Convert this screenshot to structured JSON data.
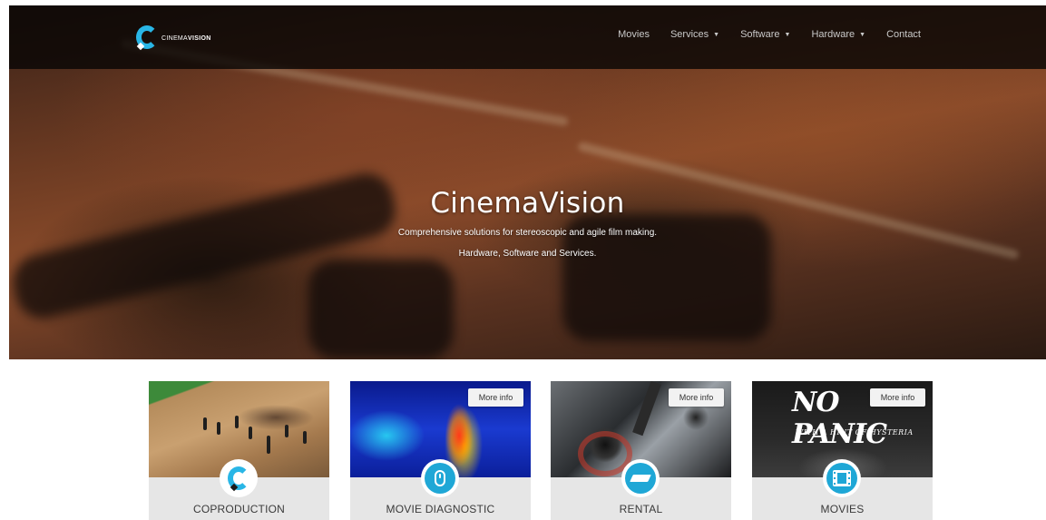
{
  "brand": {
    "name_light": "CINEMA",
    "name_bold": "VISION",
    "accent_color": "#29b6e6"
  },
  "nav": {
    "items": [
      {
        "label": "Movies",
        "has_dropdown": false
      },
      {
        "label": "Services",
        "has_dropdown": true
      },
      {
        "label": "Software",
        "has_dropdown": true
      },
      {
        "label": "Hardware",
        "has_dropdown": true
      },
      {
        "label": "Contact",
        "has_dropdown": false
      }
    ],
    "dropdown_glyph": "▼"
  },
  "hero": {
    "title": "CinemaVision",
    "subtitle_line1": "Comprehensive solutions for stereoscopic and agile film making.",
    "subtitle_line2": "Hardware, Software and Services."
  },
  "cards": [
    {
      "title": "COPRODUCTION",
      "icon": "cinemavision-logo-icon",
      "more_info": null
    },
    {
      "title": "MOVIE DIAGNOSTIC",
      "icon": "mouse-icon",
      "more_info": "More info"
    },
    {
      "title": "RENTAL",
      "icon": "camera-lens-icon",
      "more_info": "More info"
    },
    {
      "title": "MOVIES",
      "icon": "film-strip-icon",
      "more_info": "More info"
    }
  ],
  "movie_poster": {
    "title": "NO PANIC",
    "subtitle": "WITH A HINT OF HYSTERIA"
  }
}
